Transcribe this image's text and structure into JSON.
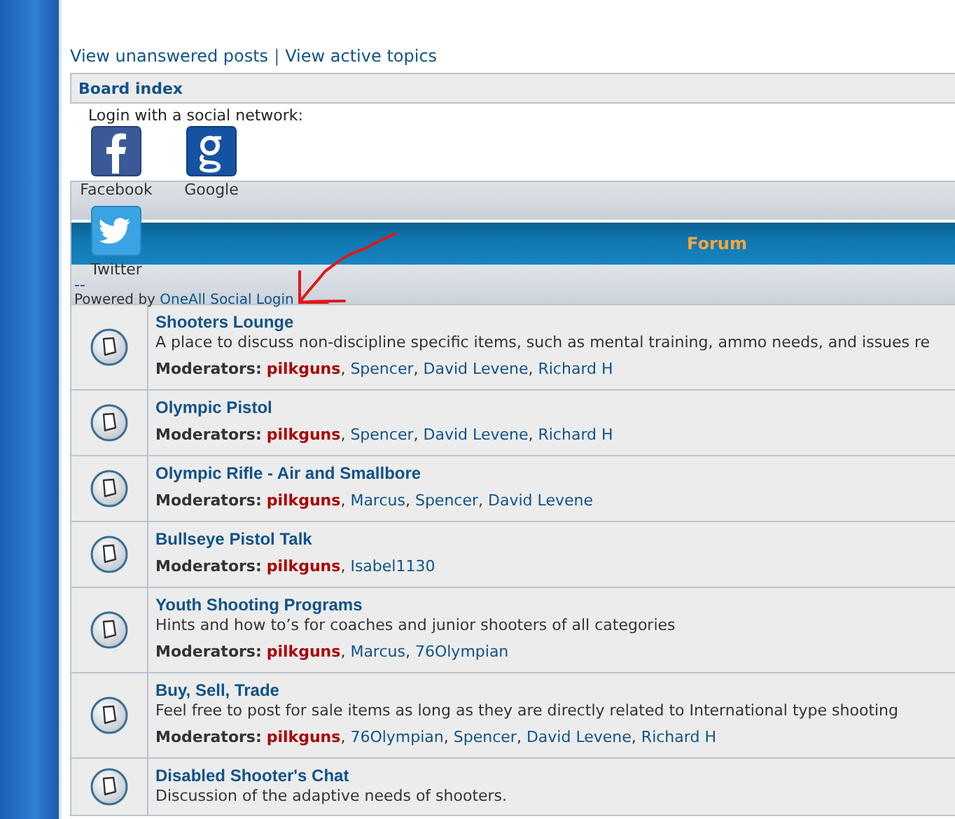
{
  "nav_links": [
    {
      "label": "View unanswered posts"
    },
    {
      "label": "View active topics"
    }
  ],
  "nav_separator": "|",
  "breadcrumb": "Board index",
  "social_login": {
    "title": "Login with a social network:",
    "providers": [
      {
        "kind": "facebook",
        "label": "Facebook"
      },
      {
        "kind": "google",
        "label": "Google"
      },
      {
        "kind": "twitter",
        "label": "Twitter"
      }
    ],
    "divider": "--",
    "powered_by": "Powered by",
    "powered_link": "OneAll Social Login"
  },
  "forum_table": {
    "header": "Forum",
    "separator": ", ",
    "forums": [
      {
        "title": "Shooters Lounge",
        "description": "A place to discuss non-discipline specific items, such as mental training, ammo needs, and issues re",
        "moderators_label": "Moderators:",
        "moderators": [
          {
            "name": "pilkguns",
            "kind": "admin"
          },
          {
            "name": "Spencer",
            "kind": "moderator"
          },
          {
            "name": "David Levene",
            "kind": "moderator"
          },
          {
            "name": "Richard H",
            "kind": "moderator"
          }
        ]
      },
      {
        "title": "Olympic Pistol",
        "moderators_label": "Moderators:",
        "moderators": [
          {
            "name": "pilkguns",
            "kind": "admin"
          },
          {
            "name": "Spencer",
            "kind": "moderator"
          },
          {
            "name": "David Levene",
            "kind": "moderator"
          },
          {
            "name": "Richard H",
            "kind": "moderator"
          }
        ]
      },
      {
        "title": "Olympic Rifle - Air and Smallbore",
        "moderators_label": "Moderators:",
        "moderators": [
          {
            "name": "pilkguns",
            "kind": "admin"
          },
          {
            "name": "Marcus",
            "kind": "moderator"
          },
          {
            "name": "Spencer",
            "kind": "moderator"
          },
          {
            "name": "David Levene",
            "kind": "moderator"
          }
        ]
      },
      {
        "title": "Bullseye Pistol Talk",
        "moderators_label": "Moderators:",
        "moderators": [
          {
            "name": "pilkguns",
            "kind": "admin"
          },
          {
            "name": "Isabel1130",
            "kind": "moderator"
          }
        ]
      },
      {
        "title": "Youth Shooting Programs",
        "description": "Hints and how to’s for coaches and junior shooters of all categories",
        "moderators_label": "Moderators:",
        "moderators": [
          {
            "name": "pilkguns",
            "kind": "admin"
          },
          {
            "name": "Marcus",
            "kind": "moderator"
          },
          {
            "name": "76Olympian",
            "kind": "moderator"
          }
        ]
      },
      {
        "title": "Buy, Sell, Trade",
        "description": "Feel free to post for sale items as long as they are directly related to International type shooting",
        "moderators_label": "Moderators:",
        "moderators": [
          {
            "name": "pilkguns",
            "kind": "admin"
          },
          {
            "name": "76Olympian",
            "kind": "moderator"
          },
          {
            "name": "Spencer",
            "kind": "moderator"
          },
          {
            "name": "David Levene",
            "kind": "moderator"
          },
          {
            "name": "Richard H",
            "kind": "moderator"
          }
        ]
      },
      {
        "title": "Disabled Shooter's Chat",
        "description": "Discussion of the adaptive needs of shooters."
      }
    ]
  }
}
